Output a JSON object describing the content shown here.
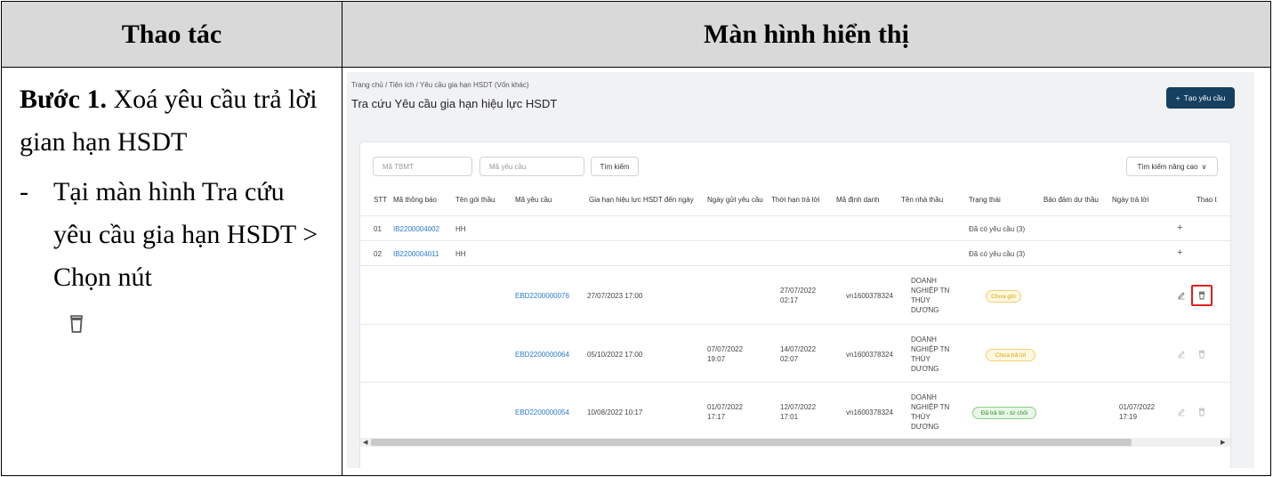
{
  "table": {
    "col1_header": "Thao tác",
    "col2_header": "Màn hình hiển thị"
  },
  "step": {
    "title_bold": "Bước 1.",
    "title_rest": " Xoá yêu cầu trả lời gian hạn HSDT",
    "bullet_dash": "-",
    "bullet_text": "Tại màn hình Tra cứu yêu cầu gia hạn HSDT > Chọn nút",
    "icon": "trash-icon"
  },
  "screen": {
    "breadcrumb": "Trang chủ / Tiện ích / Yêu cầu gia hạn HSDT (Vốn khác)",
    "page_title": "Tra cứu Yêu cầu gia hạn hiệu lực HSDT",
    "create_button": "Tạo yêu cầu",
    "filters": {
      "tbmt_placeholder": "Mã TBMT",
      "request_placeholder": "Mã yêu cầu",
      "search_button": "Tìm kiếm",
      "advanced_button": "Tìm kiếm nâng cao"
    },
    "columns": [
      "STT",
      "Mã thông báo",
      "Tên gói thầu",
      "Mã yêu cầu",
      "Gia hạn hiệu lực HSDT đến ngày",
      "Ngày gửi yêu cầu",
      "Thời hạn trả lời",
      "Mã định danh",
      "Tên nhà thầu",
      "Trạng thái",
      "Bảo đảm dự thầu",
      "Ngày trả lời",
      "Thao t"
    ],
    "group_rows": [
      {
        "stt": "01",
        "notice": "IB2200004002",
        "package": "HH",
        "status": "Đã có yêu cầu (3)"
      },
      {
        "stt": "02",
        "notice": "IB2200004011",
        "package": "HH",
        "status": "Đã có yêu cầu (3)"
      }
    ],
    "detail_rows": [
      {
        "code": "EBD2200000076",
        "extend": "27/07/2023 17:00",
        "sent_d": "",
        "sent_t": "",
        "deadline_d": "27/07/2022",
        "deadline_t": "02:17",
        "id": "vn1600378324",
        "b1": "DOANH",
        "b2": "NGHIỆP TN",
        "b3": "THÙY",
        "b4": "DƯƠNG",
        "status": "Chưa gửi",
        "reply_d": "",
        "reply_t": ""
      },
      {
        "code": "EBD2200000064",
        "extend": "05/10/2022 17:00",
        "sent_d": "07/07/2022",
        "sent_t": "19:07",
        "deadline_d": "14/07/2022",
        "deadline_t": "02:07",
        "id": "vn1600378324",
        "b1": "DOANH",
        "b2": "NGHIỆP TN",
        "b3": "THÙY",
        "b4": "DƯƠNG",
        "status": "Chưa trả lời",
        "reply_d": "",
        "reply_t": ""
      },
      {
        "code": "EBD2200000054",
        "extend": "10/08/2022 10:17",
        "sent_d": "01/07/2022",
        "sent_t": "17:17",
        "deadline_d": "12/07/2022",
        "deadline_t": "17:01",
        "id": "vn1600378324",
        "b1": "DOANH",
        "b2": "NGHIỆP TN",
        "b3": "THÙY",
        "b4": "DƯƠNG",
        "status": "Đã trả lời - từ chối",
        "reply_d": "01/07/2022",
        "reply_t": "17:19"
      }
    ],
    "colors": {
      "primary": "#15405f",
      "link": "#2b7bd1",
      "highlight": "#e02020"
    }
  }
}
